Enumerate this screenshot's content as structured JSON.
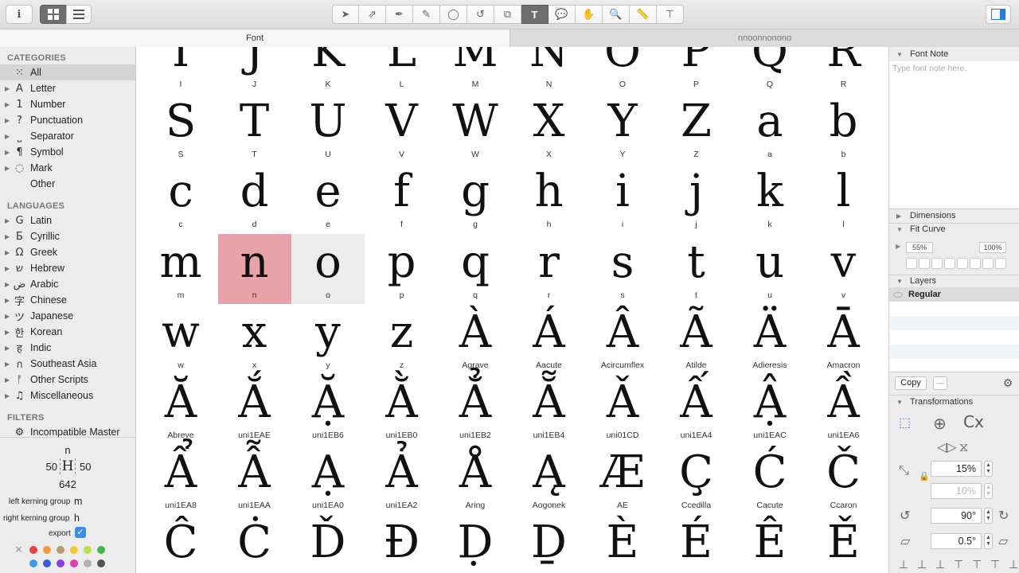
{
  "tabs": {
    "font": "Font",
    "edit": "nnoonnonono"
  },
  "toolbar": {
    "icons": [
      "select-icon",
      "select-all-icon",
      "pen-icon",
      "pencil-icon",
      "circle-icon",
      "rotate-icon",
      "scale-icon",
      "text-icon",
      "annotation-icon",
      "hand-icon",
      "zoom-icon",
      "measure-icon",
      "rulers-icon"
    ]
  },
  "sidebar": {
    "categories_title": "CATEGORIES",
    "categories": [
      {
        "label": "All",
        "glyph": "⁙",
        "selected": true,
        "tri": false
      },
      {
        "label": "Letter",
        "glyph": "A",
        "tri": true
      },
      {
        "label": "Number",
        "glyph": "1",
        "tri": true
      },
      {
        "label": "Punctuation",
        "glyph": "?",
        "tri": true
      },
      {
        "label": "Separator",
        "glyph": "⎵",
        "tri": true
      },
      {
        "label": "Symbol",
        "glyph": "¶",
        "tri": true
      },
      {
        "label": "Mark",
        "glyph": "◌",
        "tri": true
      },
      {
        "label": "Other",
        "glyph": "",
        "tri": false
      }
    ],
    "languages_title": "LANGUAGES",
    "languages": [
      {
        "label": "Latin",
        "glyph": "G"
      },
      {
        "label": "Cyrillic",
        "glyph": "Б"
      },
      {
        "label": "Greek",
        "glyph": "Ω"
      },
      {
        "label": "Hebrew",
        "glyph": "ש"
      },
      {
        "label": "Arabic",
        "glyph": "ض"
      },
      {
        "label": "Chinese",
        "glyph": "字"
      },
      {
        "label": "Japanese",
        "glyph": "ツ"
      },
      {
        "label": "Korean",
        "glyph": "한"
      },
      {
        "label": "Indic",
        "glyph": "ह"
      },
      {
        "label": "Southeast Asia",
        "glyph": "ก"
      },
      {
        "label": "Other Scripts",
        "glyph": "ᚠ"
      },
      {
        "label": "Miscellaneous",
        "glyph": "♫"
      }
    ],
    "filters_title": "FILTERS",
    "filters": [
      {
        "label": "Incompatible Master",
        "glyph": "⚙"
      }
    ]
  },
  "info": {
    "glyph_name": "n",
    "lsb": "50",
    "rsb": "50",
    "width": "642",
    "left_kerning_label": "left kerning group",
    "left_kerning_value": "m",
    "right_kerning_label": "right kerning group",
    "right_kerning_value": "h",
    "export_label": "export",
    "export_check": "✓",
    "clear_icon": "✕",
    "colors": [
      "#e0453f",
      "#f39a3b",
      "#b99a6b",
      "#f3c93a",
      "#b9e04a",
      "#3fb54a",
      "#3f9ae0",
      "#3f5ae0",
      "#8a3fe0",
      "#e03fae",
      "#b0b0b0",
      "#555555"
    ]
  },
  "glyphs": [
    {
      "g": "I",
      "n": "I"
    },
    {
      "g": "J",
      "n": "J"
    },
    {
      "g": "K",
      "n": "K"
    },
    {
      "g": "L",
      "n": "L"
    },
    {
      "g": "M",
      "n": "M"
    },
    {
      "g": "N",
      "n": "N"
    },
    {
      "g": "O",
      "n": "O"
    },
    {
      "g": "P",
      "n": "P"
    },
    {
      "g": "Q",
      "n": "Q"
    },
    {
      "g": "R",
      "n": "R"
    },
    {
      "g": "S",
      "n": "S"
    },
    {
      "g": "T",
      "n": "T"
    },
    {
      "g": "U",
      "n": "U"
    },
    {
      "g": "V",
      "n": "V"
    },
    {
      "g": "W",
      "n": "W"
    },
    {
      "g": "X",
      "n": "X"
    },
    {
      "g": "Y",
      "n": "Y"
    },
    {
      "g": "Z",
      "n": "Z"
    },
    {
      "g": "a",
      "n": "a"
    },
    {
      "g": "b",
      "n": "b"
    },
    {
      "g": "c",
      "n": "c"
    },
    {
      "g": "d",
      "n": "d"
    },
    {
      "g": "e",
      "n": "e"
    },
    {
      "g": "f",
      "n": "f"
    },
    {
      "g": "g",
      "n": "g"
    },
    {
      "g": "h",
      "n": "h"
    },
    {
      "g": "i",
      "n": "i"
    },
    {
      "g": "j",
      "n": "j"
    },
    {
      "g": "k",
      "n": "k"
    },
    {
      "g": "l",
      "n": "l"
    },
    {
      "g": "m",
      "n": "m"
    },
    {
      "g": "n",
      "n": "n",
      "state": "selected"
    },
    {
      "g": "o",
      "n": "o",
      "state": "highlight"
    },
    {
      "g": "p",
      "n": "p"
    },
    {
      "g": "q",
      "n": "q"
    },
    {
      "g": "r",
      "n": "r"
    },
    {
      "g": "s",
      "n": "s"
    },
    {
      "g": "t",
      "n": "t"
    },
    {
      "g": "u",
      "n": "u"
    },
    {
      "g": "v",
      "n": "v"
    },
    {
      "g": "w",
      "n": "w"
    },
    {
      "g": "x",
      "n": "x"
    },
    {
      "g": "y",
      "n": "y"
    },
    {
      "g": "z",
      "n": "z"
    },
    {
      "g": "À",
      "n": "Agrave"
    },
    {
      "g": "Á",
      "n": "Aacute"
    },
    {
      "g": "Â",
      "n": "Acircumflex"
    },
    {
      "g": "Ã",
      "n": "Atilde"
    },
    {
      "g": "Ä",
      "n": "Adieresis"
    },
    {
      "g": "Ā",
      "n": "Amacron"
    },
    {
      "g": "Ă",
      "n": "Abreve"
    },
    {
      "g": "Ắ",
      "n": "uni1EAE"
    },
    {
      "g": "Ặ",
      "n": "uni1EB6"
    },
    {
      "g": "Ằ",
      "n": "uni1EB0"
    },
    {
      "g": "Ẳ",
      "n": "uni1EB2"
    },
    {
      "g": "Ẵ",
      "n": "uni1EB4"
    },
    {
      "g": "Ǎ",
      "n": "uni01CD"
    },
    {
      "g": "Ấ",
      "n": "uni1EA4"
    },
    {
      "g": "Ậ",
      "n": "uni1EAC"
    },
    {
      "g": "Ầ",
      "n": "uni1EA6"
    },
    {
      "g": "Ẩ",
      "n": "uni1EA8"
    },
    {
      "g": "Ẫ",
      "n": "uni1EAA"
    },
    {
      "g": "Ạ",
      "n": "uni1EA0"
    },
    {
      "g": "Ả",
      "n": "uni1EA2"
    },
    {
      "g": "Å",
      "n": "Aring"
    },
    {
      "g": "Ą",
      "n": "Aogonek"
    },
    {
      "g": "Æ",
      "n": "AE"
    },
    {
      "g": "Ç",
      "n": "Ccedilla"
    },
    {
      "g": "Ć",
      "n": "Cacute"
    },
    {
      "g": "Č",
      "n": "Ccaron"
    },
    {
      "g": "Ĉ",
      "n": ""
    },
    {
      "g": "Ċ",
      "n": ""
    },
    {
      "g": "Ď",
      "n": ""
    },
    {
      "g": "Đ",
      "n": ""
    },
    {
      "g": "Ḍ",
      "n": ""
    },
    {
      "g": "Ḏ",
      "n": ""
    },
    {
      "g": "È",
      "n": ""
    },
    {
      "g": "É",
      "n": ""
    },
    {
      "g": "Ê",
      "n": ""
    },
    {
      "g": "Ě",
      "n": ""
    }
  ],
  "right": {
    "font_note_title": "Font Note",
    "font_note_placeholder": "Type font note here.",
    "dimensions_title": "Dimensions",
    "fit_curve_title": "Fit Curve",
    "fit_min": "55%",
    "fit_max": "100%",
    "layers_title": "Layers",
    "layer_name": "Regular",
    "copy_label": "Copy",
    "minus_label": "—",
    "transformations_title": "Transformations",
    "scale_value": "15%",
    "scale_value2": "10%",
    "rotate_value": "90°",
    "slant_value": "0.5°",
    "cx_label": "Cx"
  },
  "colors": {
    "selected_cell": "#e8a3aa",
    "highlight_cell": "#ececec",
    "checkbox": "#3a8ee6"
  }
}
